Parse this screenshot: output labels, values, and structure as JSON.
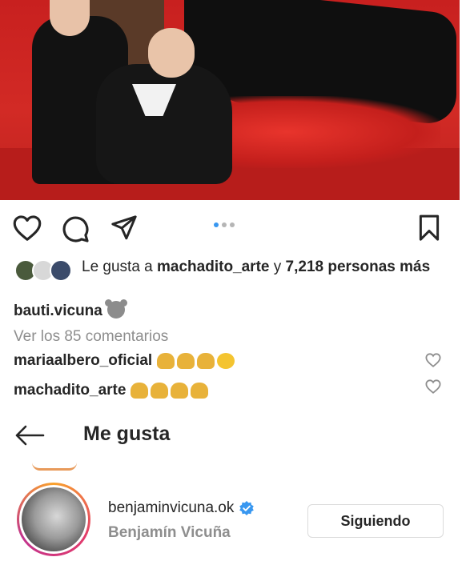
{
  "post": {
    "actions": {
      "like_icon": "heart-icon",
      "comment_icon": "comment-icon",
      "share_icon": "send-icon",
      "save_icon": "bookmark-icon"
    },
    "carousel": {
      "count": 3,
      "active": 1
    },
    "likes": {
      "prefix": "Le gusta a ",
      "user": "machadito_arte",
      "middle": " y ",
      "count": "7,218 personas",
      "suffix": " más"
    },
    "caption_user": "bauti.vicuna",
    "view_comments": "Ver los 85 comentarios",
    "comments": [
      {
        "user": "mariaalbero_oficial"
      },
      {
        "user": "machadito_arte"
      }
    ]
  },
  "likes_sheet": {
    "title": "Me gusta",
    "users": [
      {
        "username": "benjaminvicuna.ok",
        "full_name": "Benjamín Vicuña",
        "verified": true,
        "button": "Siguiendo"
      }
    ]
  },
  "colors": {
    "verified": "#3897f0",
    "muted": "#8e8e8e",
    "text": "#262626"
  }
}
